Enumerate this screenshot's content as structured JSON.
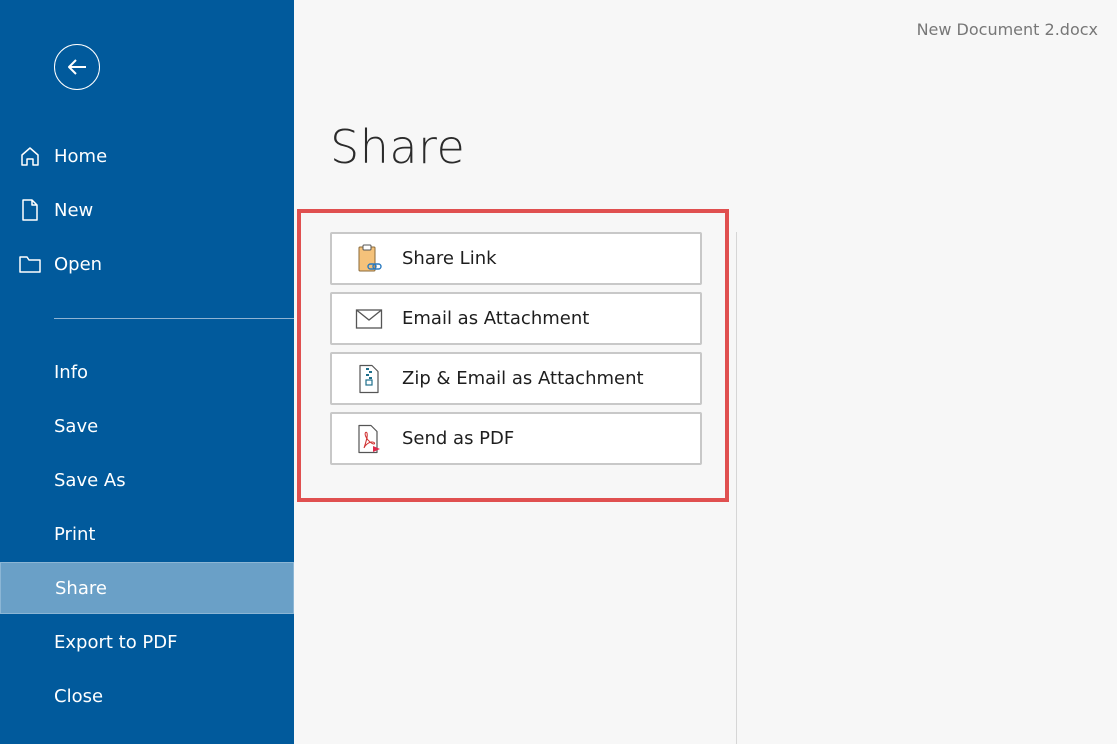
{
  "window": {
    "document_name": "New Document 2.docx"
  },
  "sidebar": {
    "back_icon": "arrow-left-circle-icon",
    "primary_items": [
      {
        "label": "Home",
        "icon": "home-icon"
      },
      {
        "label": "New",
        "icon": "new-document-icon"
      },
      {
        "label": "Open",
        "icon": "folder-icon"
      }
    ],
    "secondary_items": [
      {
        "label": "Info"
      },
      {
        "label": "Save"
      },
      {
        "label": "Save As"
      },
      {
        "label": "Print"
      },
      {
        "label": "Share",
        "active": true
      },
      {
        "label": "Export to PDF"
      },
      {
        "label": "Close"
      }
    ]
  },
  "main": {
    "title": "Share",
    "options": [
      {
        "label": "Share Link",
        "icon": "clipboard-link-icon"
      },
      {
        "label": "Email as Attachment",
        "icon": "envelope-icon"
      },
      {
        "label": "Zip & Email as Attachment",
        "icon": "zip-file-icon"
      },
      {
        "label": "Send as PDF",
        "icon": "pdf-file-icon"
      }
    ]
  },
  "colors": {
    "sidebar_bg": "#015a9c",
    "sidebar_active_bg": "#6aa0c7",
    "highlight_border": "#e05050",
    "page_bg": "#f7f7f7"
  }
}
